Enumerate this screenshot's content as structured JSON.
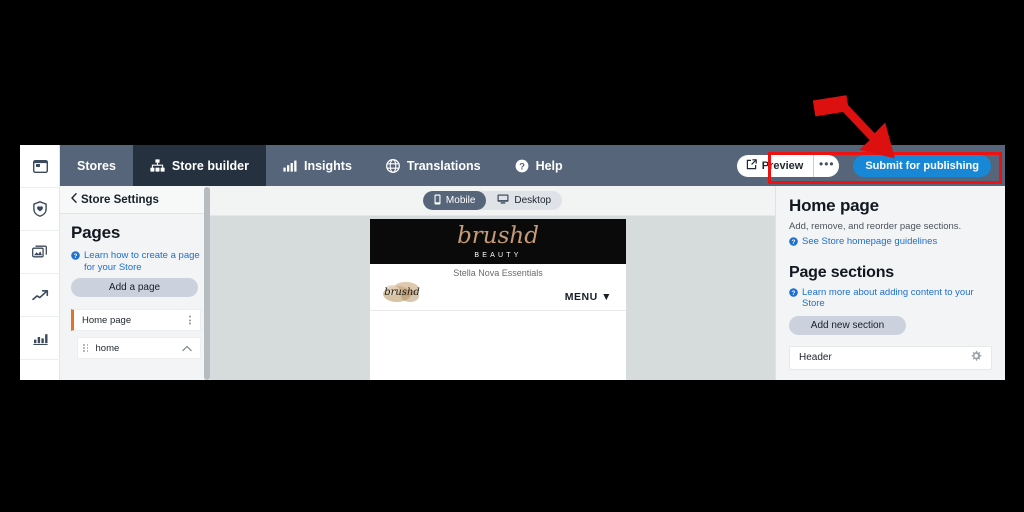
{
  "top_nav": {
    "tabs": [
      {
        "label": "Stores",
        "icon": "none",
        "active": false
      },
      {
        "label": "Store builder",
        "icon": "sitemap-icon",
        "active": true
      },
      {
        "label": "Insights",
        "icon": "bar-chart-icon",
        "active": false
      },
      {
        "label": "Translations",
        "icon": "globe-icon",
        "active": false
      },
      {
        "label": "Help",
        "icon": "question-circle-icon",
        "active": false
      }
    ],
    "preview_label": "Preview",
    "overflow_label": "•••",
    "submit_label": "Submit for publishing",
    "submit_color": "#1787d6"
  },
  "icon_rail": {
    "items": [
      {
        "icon": "browser-card-icon"
      },
      {
        "icon": "shield-heart-icon"
      },
      {
        "icon": "images-icon"
      },
      {
        "icon": "trending-up-icon"
      },
      {
        "icon": "bar-chart-icon"
      }
    ]
  },
  "settings_panel": {
    "back_label": "Store Settings",
    "pages_title": "Pages",
    "help_link": "Learn how to create a page for your Store",
    "add_page_label": "Add a page",
    "pages": [
      {
        "label": "Home page",
        "selected": true
      },
      {
        "label": "home",
        "child": true
      }
    ]
  },
  "canvas": {
    "device_options": [
      {
        "label": "Mobile",
        "icon": "phone-icon",
        "active": true
      },
      {
        "label": "Desktop",
        "icon": "monitor-icon",
        "active": false
      }
    ],
    "preview": {
      "wordmark": "brushd",
      "subwordmark": "BEAUTY",
      "store_name": "Stella Nova Essentials",
      "menu_label": "MENU"
    }
  },
  "props_panel": {
    "title": "Home page",
    "subtitle": "Add, remove, and reorder page sections.",
    "guidelines_link": "See Store homepage guidelines",
    "sections_title": "Page sections",
    "sections_help_link": "Learn more about adding content to your Store",
    "add_section_label": "Add new section",
    "sections": [
      {
        "label": "Header",
        "icon": "gear-icon"
      }
    ]
  },
  "annotations": {
    "highlight_color": "#ee1111",
    "arrow_color": "#dd1010"
  }
}
